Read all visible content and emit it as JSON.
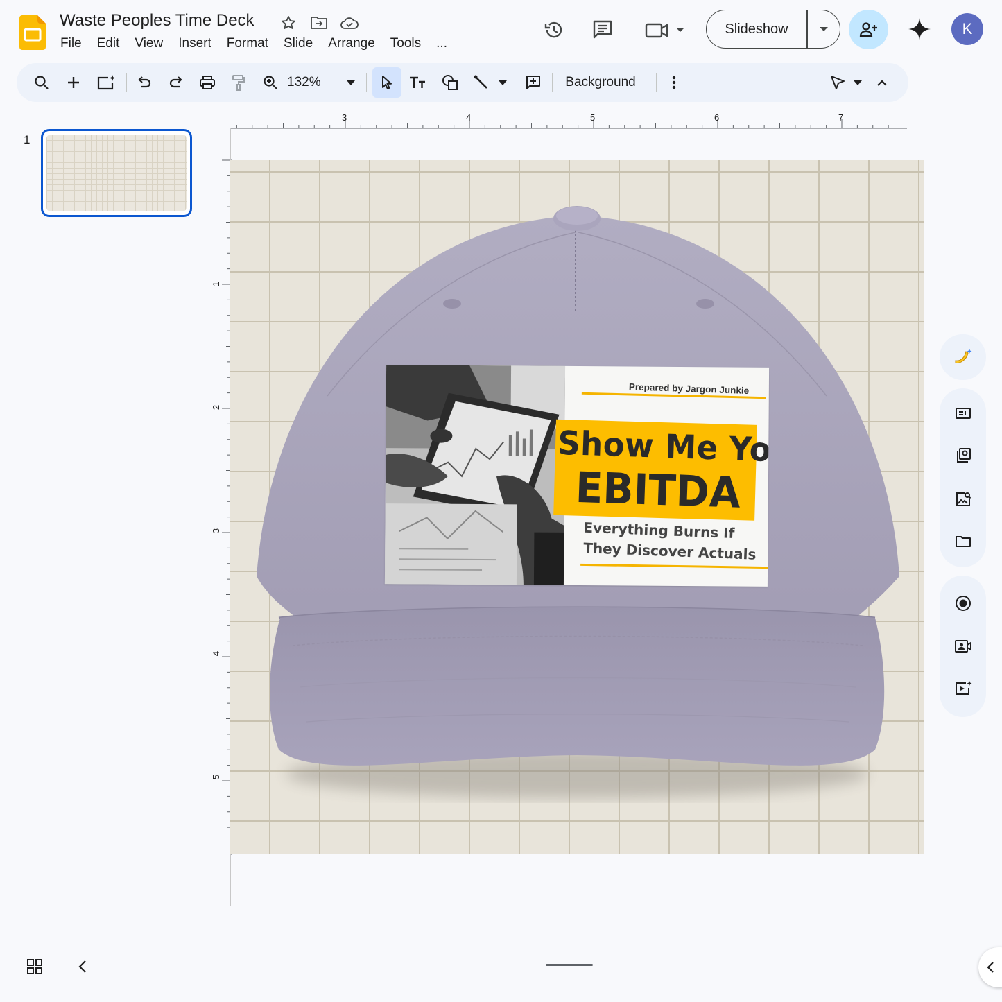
{
  "document": {
    "title": "Waste Peoples Time Deck"
  },
  "menu": [
    "File",
    "Edit",
    "View",
    "Insert",
    "Format",
    "Slide",
    "Arrange",
    "Tools",
    "..."
  ],
  "header": {
    "slideshow_label": "Slideshow",
    "avatar_initial": "K"
  },
  "toolbar": {
    "zoom": "132%",
    "background_label": "Background"
  },
  "filmstrip": {
    "slides": [
      {
        "number": "1"
      }
    ]
  },
  "rulers": {
    "horizontal_labels": [
      "3",
      "4",
      "5",
      "6",
      "7"
    ],
    "vertical_labels": [
      "1",
      "2",
      "3",
      "4",
      "5"
    ]
  },
  "slide": {
    "patch": {
      "prepared_by": "Prepared by Jargon Junkie",
      "headline_line1": "Show Me Your",
      "headline_line2": "EBITDA",
      "subtitle_line1": "Everything Burns If",
      "subtitle_line2": "They Discover Actuals"
    }
  },
  "colors": {
    "accent": "#0b57d0",
    "share_bg": "#c2e7ff",
    "avatar_bg": "#5c6bc0",
    "hat": "#a7a2b8",
    "patch_yellow": "#fdbd00",
    "slide_bg": "#e8e4da"
  },
  "icons": {
    "title": [
      "star-icon",
      "move-to-folder-icon",
      "cloud-saved-icon"
    ],
    "header": [
      "version-history-icon",
      "comments-icon",
      "meet-camera-icon",
      "add-person-icon",
      "gemini-spark-icon"
    ],
    "side_panel": [
      "banana-ai-icon",
      "slide-layout-icon",
      "replace-image-icon",
      "image-search-icon",
      "folder-icon",
      "record-icon",
      "camera-record-icon",
      "video-insert-icon"
    ]
  }
}
